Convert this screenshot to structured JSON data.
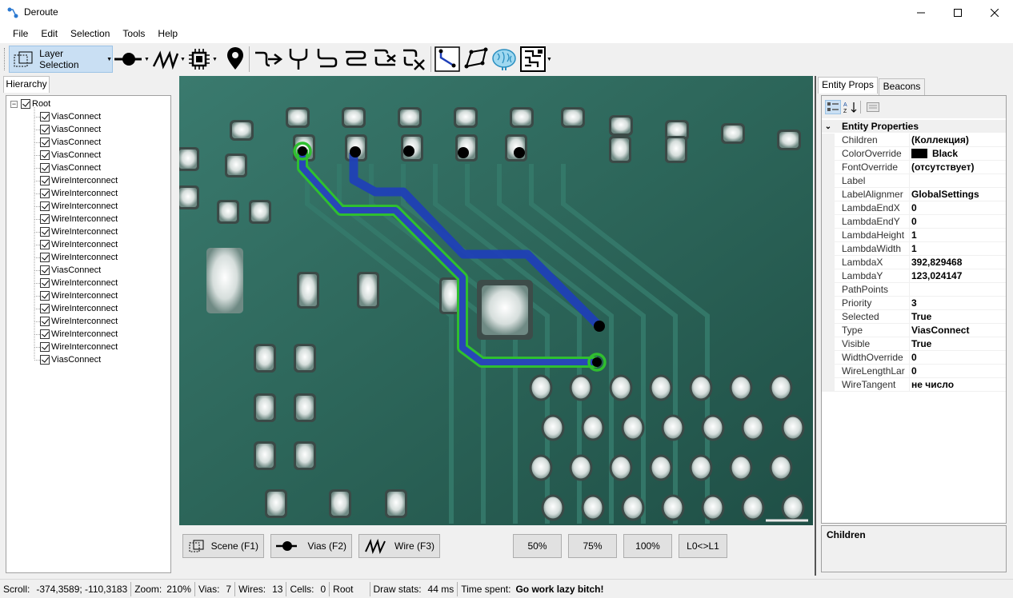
{
  "window": {
    "title": "Deroute"
  },
  "menu": [
    "File",
    "Edit",
    "Selection",
    "Tools",
    "Help"
  ],
  "toolbar": {
    "layer_selection_label": "Layer Selection"
  },
  "left_panel": {
    "tab": "Hierarchy",
    "root": "Root",
    "items": [
      "ViasConnect",
      "ViasConnect",
      "ViasConnect",
      "ViasConnect",
      "ViasConnect",
      "WireInterconnect",
      "WireInterconnect",
      "WireInterconnect",
      "WireInterconnect",
      "WireInterconnect",
      "WireInterconnect",
      "WireInterconnect",
      "ViasConnect",
      "WireInterconnect",
      "WireInterconnect",
      "WireInterconnect",
      "WireInterconnect",
      "WireInterconnect",
      "WireInterconnect",
      "ViasConnect"
    ]
  },
  "bottom_buttons": {
    "scene": "Scene (F1)",
    "vias": "Vias (F2)",
    "wire": "Wire (F3)",
    "zoom50": "50%",
    "zoom75": "75%",
    "zoom100": "100%",
    "layer_swap": "L0<>L1"
  },
  "right_panel": {
    "tabs": [
      "Entity Props",
      "Beacons"
    ],
    "category": "Entity Properties",
    "properties": [
      {
        "name": "Children",
        "value": "(Коллекция)"
      },
      {
        "name": "ColorOverride",
        "value": "Black",
        "swatch": "#000000"
      },
      {
        "name": "FontOverride",
        "value": "(отсутствует)"
      },
      {
        "name": "Label",
        "value": ""
      },
      {
        "name": "LabelAlignmer",
        "value": "GlobalSettings"
      },
      {
        "name": "LambdaEndX",
        "value": "0"
      },
      {
        "name": "LambdaEndY",
        "value": "0"
      },
      {
        "name": "LambdaHeight",
        "value": "1"
      },
      {
        "name": "LambdaWidth",
        "value": "1"
      },
      {
        "name": "LambdaX",
        "value": "392,829468"
      },
      {
        "name": "LambdaY",
        "value": "123,024147"
      },
      {
        "name": "PathPoints",
        "value": ""
      },
      {
        "name": "Priority",
        "value": "3"
      },
      {
        "name": "Selected",
        "value": "True"
      },
      {
        "name": "Type",
        "value": "ViasConnect"
      },
      {
        "name": "Visible",
        "value": "True"
      },
      {
        "name": "WidthOverride",
        "value": "0"
      },
      {
        "name": "WireLengthLar",
        "value": "0"
      },
      {
        "name": "WireTangent",
        "value": "не число"
      }
    ],
    "description_title": "Children"
  },
  "status": {
    "scroll_label": "Scroll:",
    "scroll_value": "-374,3589; -110,3183",
    "zoom_label": "Zoom:",
    "zoom_value": "210%",
    "vias_label": "Vias:",
    "vias_value": "7",
    "wires_label": "Wires:",
    "wires_value": "13",
    "cells_label": "Cells:",
    "cells_value": "0",
    "layer": "Root",
    "draw_label": "Draw stats:",
    "draw_value": "44 ms",
    "time_label": "Time spent:",
    "time_value": "Go work lazy bitch!"
  },
  "colors": {
    "pcb": "#2f6a5e",
    "wire_blue": "#1e3fb8",
    "wire_green": "#2fbf2f",
    "accent": "#c9dff3"
  }
}
